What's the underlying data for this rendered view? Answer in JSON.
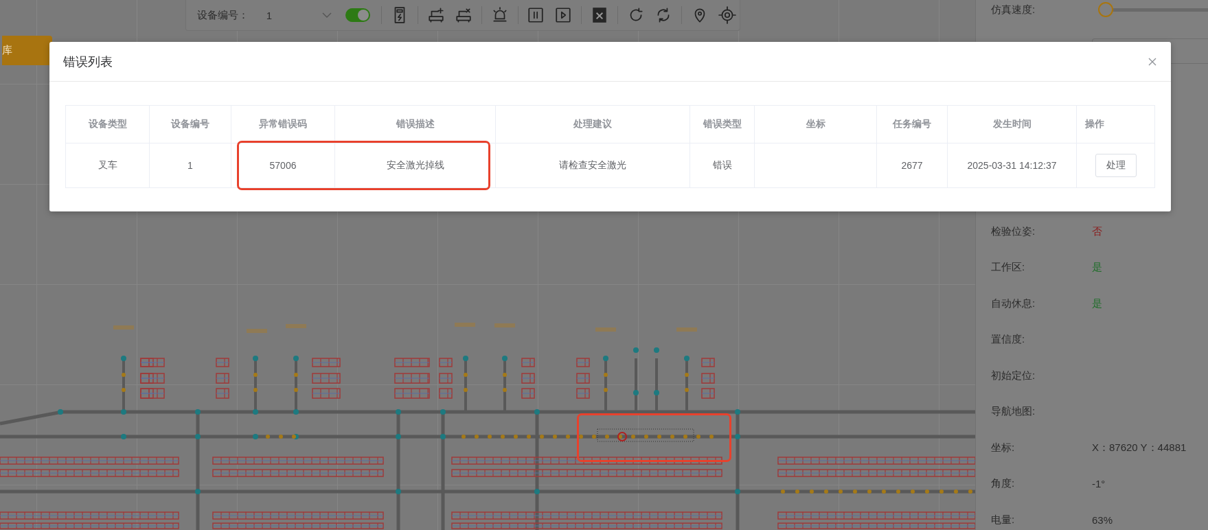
{
  "toolbar": {
    "device_label": "设备编号：",
    "device_value": "1",
    "switch_on": true
  },
  "side_tab": {
    "label": "库"
  },
  "right_panel": {
    "speed": {
      "label": "仿真速度:",
      "level": 0
    },
    "rows": [
      {
        "label": "检验位姿:",
        "value": "否",
        "color": "#8b1a1a"
      },
      {
        "label": "工作区:",
        "value": "是",
        "color": "#1f6e2a"
      },
      {
        "label": "自动休息:",
        "value": "是",
        "color": "#1f6e2a"
      },
      {
        "label": "置信度:"
      },
      {
        "label": "初始定位:"
      },
      {
        "label": "导航地图:"
      },
      {
        "label": "坐标:",
        "value": "X：87620 Y：44881"
      },
      {
        "label": "角度:",
        "value": "-1°"
      },
      {
        "label": "电量:",
        "value": "63%"
      }
    ]
  },
  "dialog": {
    "title": "错误列表",
    "table": {
      "columns": [
        "设备类型",
        "设备编号",
        "异常错误码",
        "错误描述",
        "处理建议",
        "错误类型",
        "坐标",
        "任务编号",
        "发生时间",
        "操作"
      ],
      "rows": [
        {
          "cells": [
            "叉车",
            "1",
            "57006",
            "安全激光掉线",
            "请检查安全激光",
            "错误",
            null,
            "2677",
            "2025-03-31 14:12:37"
          ],
          "action": "处理"
        }
      ]
    }
  }
}
